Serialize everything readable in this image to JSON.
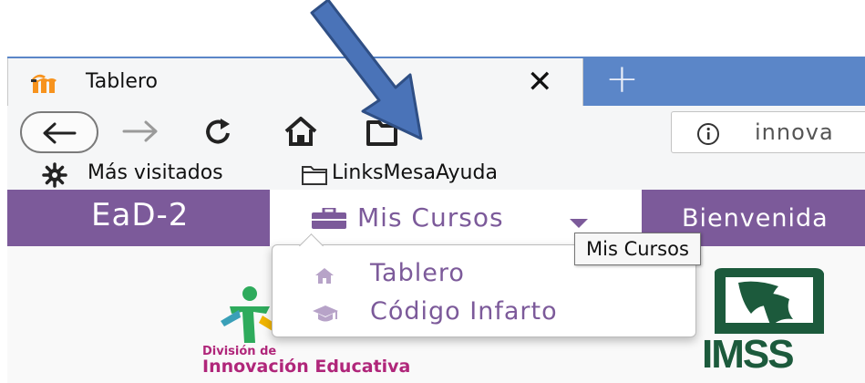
{
  "browser": {
    "tab": {
      "title": "Tablero",
      "close_glyph": "✕",
      "favicon": "moodle-logo-icon"
    },
    "new_tab_glyph": "+",
    "toolbar": {
      "back": "back-arrow-icon",
      "forward": "forward-arrow-icon",
      "reload": "reload-icon",
      "home": "home-icon",
      "library": "library-icon"
    },
    "url_text": "innova",
    "bookmarks": [
      {
        "label": "Más visitados",
        "icon": "gear-icon"
      },
      {
        "label": "LinksMesaAyuda",
        "icon": "folder-icon"
      }
    ]
  },
  "navbar": {
    "brand": "EaD-2",
    "menu_label": "Mis Cursos",
    "right_label": "Bienvenida",
    "color": "#7c5a9a"
  },
  "tooltip": "Mis Cursos",
  "dropdown": {
    "items": [
      {
        "label": "Tablero",
        "icon": "home-icon"
      },
      {
        "label": "Código Infarto",
        "icon": "graduation-cap-icon"
      }
    ]
  },
  "logos": {
    "die_line1": "División de",
    "die_line2": "Innovación Educativa",
    "imss": "IMSS"
  },
  "annotation_color": "#4a73b8"
}
